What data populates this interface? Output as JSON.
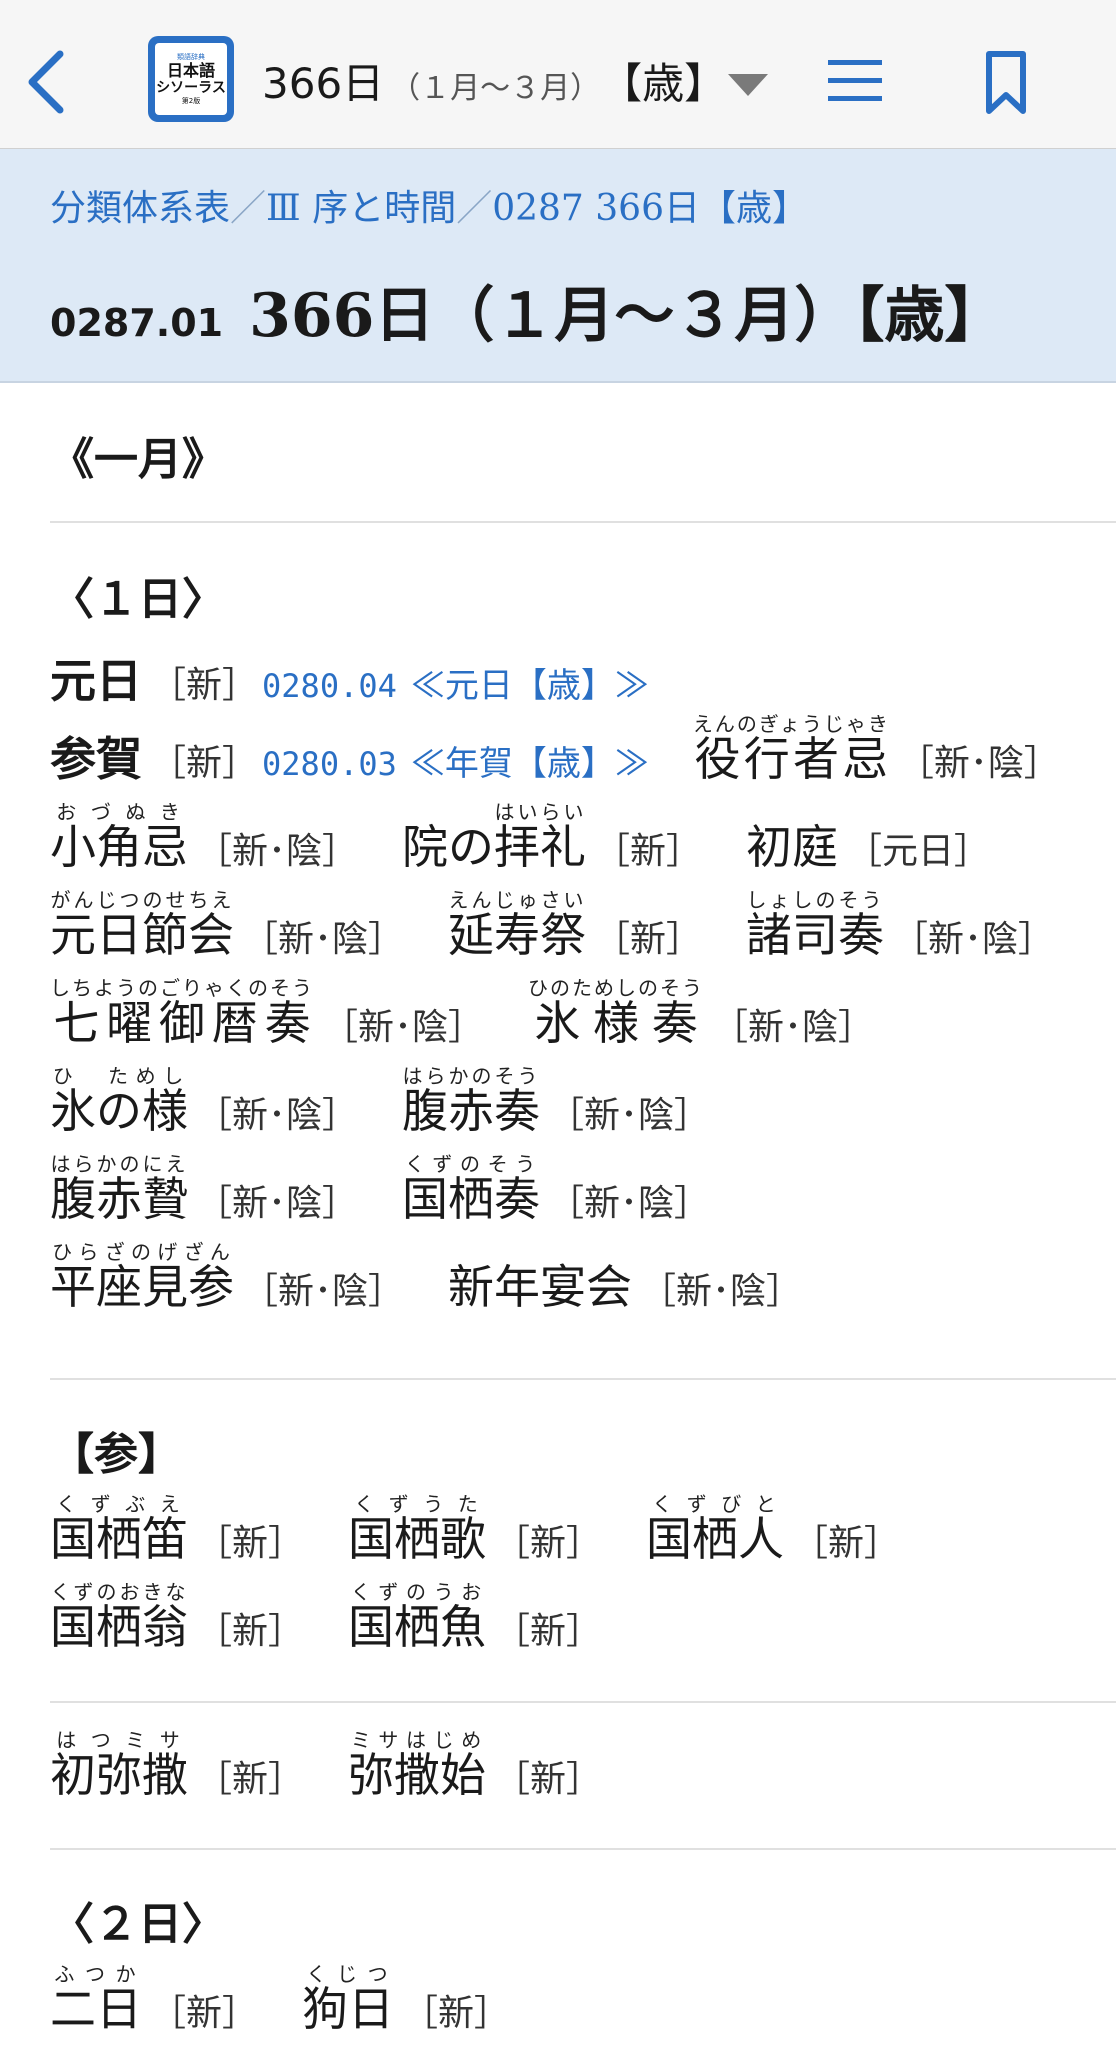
{
  "topbar": {
    "app_icon_text": [
      "類語辞典",
      "日本語",
      "シソーラス",
      "第2版"
    ],
    "title_main": "366日",
    "title_sub": "（１月～３月）",
    "title_bracket": "【歳】"
  },
  "header": {
    "breadcrumb": [
      "分類体系表",
      "Ⅲ 序と時間",
      "0287 366日【歳】"
    ],
    "breadcrumb_sep": "／",
    "code": "0287.01",
    "title": "366日（１月～３月）【歳】"
  },
  "sections": {
    "month1": "《一月》",
    "day1": "〈１日〉",
    "san": "【参】",
    "day2": "〈２日〉"
  },
  "entries": {
    "ganjitsu": {
      "word": "元日",
      "tag": "［新］",
      "link_code": "0280.04",
      "link_title": "≪元日【歳】≫"
    },
    "sanga": {
      "word": "参賀",
      "tag": "［新］",
      "link_code": "0280.03",
      "link_title": "≪年賀【歳】≫"
    },
    "ennogyoujaki": {
      "word": "役行者忌",
      "reading": "えんのぎょうじゃき",
      "tag": "［新･陰］"
    },
    "ozunuki": {
      "word": "小角忌",
      "reading": "おづぬき",
      "tag": "［新･陰］"
    },
    "innohairai": {
      "base": "院の",
      "word": "拝礼",
      "reading": "はいらい",
      "tag": "［新］"
    },
    "hatsuniwa": {
      "word": "初庭",
      "tag": "［元日］"
    },
    "ganjitsunosechie": {
      "word": "元日節会",
      "reading": "がんじつのせちえ",
      "tag": "［新･陰］"
    },
    "enjusai": {
      "word": "延寿祭",
      "reading": "えんじゅさい",
      "tag": "［新］"
    },
    "shoshinosou": {
      "word": "諸司奏",
      "reading": "しょしのそう",
      "tag": "［新･陰］"
    },
    "shichiyou": {
      "word": "七曜御暦奏",
      "reading": "しちようのごりゃくのそう",
      "tag": "［新･陰］"
    },
    "hinotameshinosou": {
      "word": "氷様奏",
      "reading": "ひのためしのそう",
      "tag": "［新･陰］"
    },
    "hinotameshi": {
      "word": "氷の様",
      "reading": "ひ　ためし",
      "tag": "［新･陰］"
    },
    "harakanosou": {
      "word": "腹赤奏",
      "reading": "はらかのそう",
      "tag": "［新･陰］"
    },
    "harakanonie": {
      "word": "腹赤贄",
      "reading": "はらかのにえ",
      "tag": "［新･陰］"
    },
    "kuzunosou": {
      "word": "国栖奏",
      "reading": "くずのそう",
      "tag": "［新･陰］"
    },
    "hirazanogezan": {
      "word": "平座見参",
      "reading": "ひらざのげざん",
      "tag": "［新･陰］"
    },
    "shinnenenkai": {
      "word": "新年宴会",
      "tag": "［新･陰］"
    },
    "kuzubue": {
      "word": "国栖笛",
      "reading": "くずぶえ",
      "tag": "［新］"
    },
    "kuzuuta": {
      "word": "国栖歌",
      "reading": "くずうた",
      "tag": "［新］"
    },
    "kuzubito": {
      "word": "国栖人",
      "reading": "くずびと",
      "tag": "［新］"
    },
    "kuzunookina": {
      "word": "国栖翁",
      "reading": "くずのおきな",
      "tag": "［新］"
    },
    "kuzunouo": {
      "word": "国栖魚",
      "reading": "くずのうお",
      "tag": "［新］"
    },
    "hatsumisa": {
      "word": "初弥撒",
      "reading": "はつミサ",
      "tag": "［新］"
    },
    "misahajime": {
      "word": "弥撒始",
      "reading": "ミサはじめ",
      "tag": "［新］"
    },
    "futsuka": {
      "word": "二日",
      "reading": "ふつか",
      "tag": "［新］"
    },
    "kujitsu": {
      "word": "狗日",
      "reading": "くじつ",
      "tag": "［新］"
    }
  }
}
